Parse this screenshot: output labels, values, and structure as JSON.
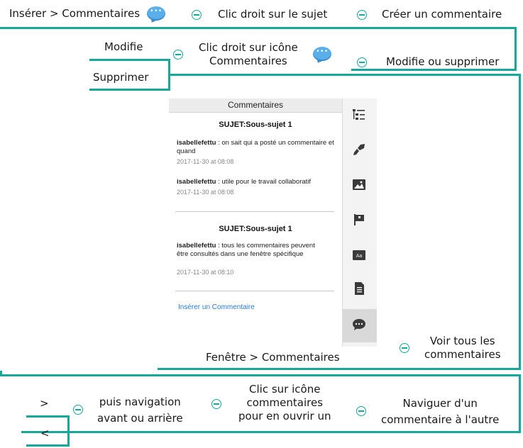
{
  "top_row": {
    "insert_label": "Insérer > Commentaires",
    "right_click_subject": "Clic droit sur le sujet",
    "create_comment": "Créer un commentaire"
  },
  "second_row": {
    "modify": "Modifie",
    "right_click_icon_line1": "Clic droit sur icône",
    "right_click_icon_line2": "Commentaires",
    "modify_or_delete": "Modifie ou supprimer",
    "delete": "Supprimer"
  },
  "panel": {
    "header": "Commentaires",
    "group1_title": "SUJET:Sous-sujet  1",
    "comments_group1": [
      {
        "user": "isabellefettu",
        "text": " : on sait qui a posté un commentaire et quand",
        "date": "2017-11-30 at 08:08"
      },
      {
        "user": "isabellefettu",
        "text": " : utile pour le travail collaboratif",
        "date": "2017-11-30 at 08:08"
      }
    ],
    "group2_title": "SUJET:Sous-sujet  1",
    "comments_group2": [
      {
        "user": "isabellefettu",
        "text": " : tous les commentaires peuvent être consultés dans une fenêtre spécifique",
        "date": "2017-11-30 at 08:10"
      }
    ],
    "insert_link": "Insérer un Commentaire",
    "sidebar_icons": [
      "outline-icon",
      "brush-icon",
      "image-icon",
      "flag-icon",
      "text-style-icon",
      "document-icon",
      "comment-icon"
    ]
  },
  "window_row": {
    "window_label": "Fenêtre > Commentaires",
    "view_all_line1": "Voir tous les",
    "view_all_line2": "commentaires"
  },
  "bottom_row": {
    "next": ">",
    "prev": "<",
    "nav_line1": "puis navigation",
    "nav_line2": "avant ou arrière",
    "click_icon_line1": "Clic sur icône",
    "click_icon_line2": "commentaires",
    "click_icon_line3": "pour en ouvrir un",
    "navigate_line1": "Naviguer d'un",
    "navigate_line2": "commentaire à l'autre"
  },
  "colors": {
    "accent": "#17a89a",
    "link": "#2a7bd6",
    "bubble": "#5aaeea"
  }
}
